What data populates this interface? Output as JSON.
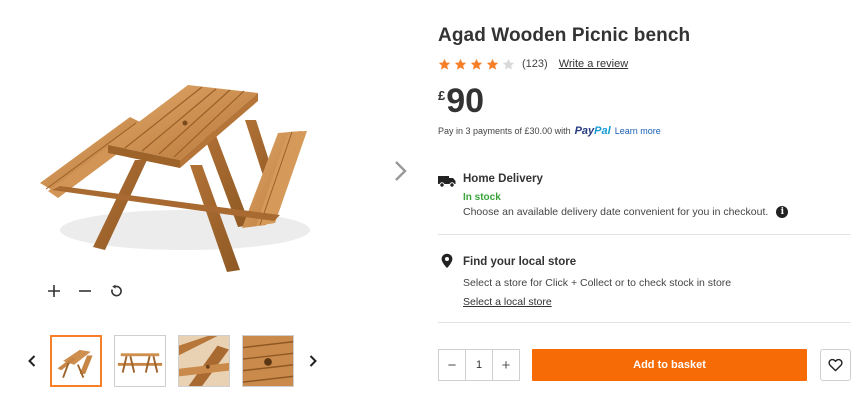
{
  "product": {
    "title": "Agad Wooden Picnic bench",
    "rating": 4,
    "rating_max": 5,
    "review_count": "(123)",
    "write_review": "Write a review"
  },
  "price": {
    "currency": "£",
    "amount": "90"
  },
  "paypal": {
    "text": "Pay in 3 payments of £30.00 with",
    "logo_part1": "Pay",
    "logo_part2": "Pal",
    "learn_more": "Learn more"
  },
  "delivery": {
    "icon": "truck-icon",
    "heading": "Home Delivery",
    "stock": "In stock",
    "text": "Choose an available delivery date convenient for you in checkout.",
    "info_glyph": "i"
  },
  "store": {
    "icon": "location-pin-icon",
    "heading": "Find your local store",
    "text": "Select a store for Click + Collect or to check stock in store",
    "link": "Select a local store"
  },
  "buy_box": {
    "qty_minus": "−",
    "qty_value": "1",
    "qty_plus": "+",
    "add_to_basket": "Add to basket",
    "wishlist_icon": "heart-icon"
  },
  "gallery": {
    "zoom_in_icon": "plus-icon",
    "zoom_out_icon": "minus-icon",
    "reset_icon": "rotate-icon",
    "thumbnails": [
      "thumbnail-1",
      "thumbnail-2",
      "thumbnail-3",
      "thumbnail-4"
    ],
    "active_thumbnail": 0
  },
  "colors": {
    "accent": "#f76b07",
    "star": "#f77f28",
    "star_empty": "#d9d9d9",
    "in_stock": "#3aa33a",
    "paypal_dark": "#253b80",
    "paypal_light": "#179bd7",
    "wood": "#c98a4b"
  }
}
